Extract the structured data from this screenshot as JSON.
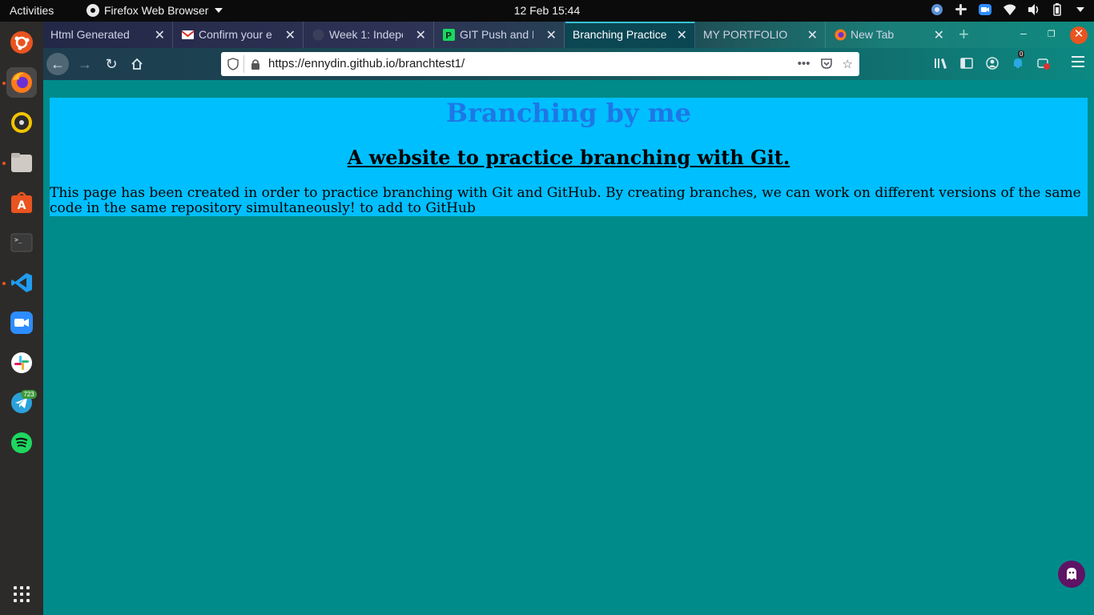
{
  "topbar": {
    "activities": "Activities",
    "app_name": "Firefox Web Browser",
    "clock": "12 Feb  15:44"
  },
  "dock": {
    "telegram_badge": "723"
  },
  "tabs": [
    {
      "label": "Html Generated",
      "active": false
    },
    {
      "label": "Confirm your e",
      "active": false
    },
    {
      "label": "Week 1: Indepe",
      "active": false
    },
    {
      "label": "GIT Push and P",
      "active": false
    },
    {
      "label": "Branching Practice",
      "active": true
    },
    {
      "label": "MY PORTFOLIO",
      "active": false
    },
    {
      "label": "New Tab",
      "active": false
    }
  ],
  "navbar": {
    "url": "https://ennydin.github.io/branchtest1/",
    "notification_count": "0"
  },
  "page": {
    "heading": "Branching by me",
    "subheading": "A website to practice branching with Git.",
    "paragraph": "This page has been created in order to practice branching with Git and GitHub. By creating branches, we can work on different versions of the same code in the same repository simultaneously! to add to GitHub"
  },
  "colors": {
    "page_background": "#008b8b",
    "banner_background": "#00bfff",
    "heading_color": "#1e77e6"
  }
}
